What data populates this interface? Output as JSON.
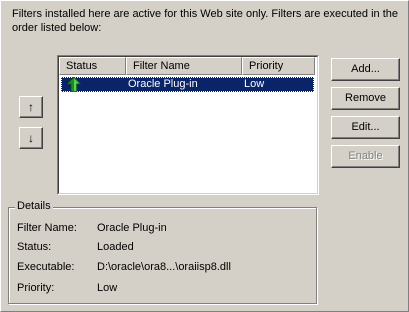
{
  "intro_text": "Filters installed here are active for this Web site only. Filters are executed in the order listed below:",
  "list": {
    "columns": [
      "Status",
      "Filter Name",
      "Priority"
    ],
    "rows": [
      {
        "status_icon": "green-up-arrow-icon",
        "name": "Oracle Plug-in",
        "priority": "Low",
        "selected": true
      }
    ]
  },
  "move_up": {
    "glyph": "↑",
    "icon": "move-up-icon"
  },
  "move_down": {
    "glyph": "↓",
    "icon": "move-down-icon"
  },
  "buttons": {
    "add": "Add...",
    "remove": "Remove",
    "edit": "Edit...",
    "enable": "Enable"
  },
  "details": {
    "title": "Details",
    "filter_name_label": "Filter Name:",
    "filter_name_value": "Oracle Plug-in",
    "status_label": "Status:",
    "status_value": "Loaded",
    "executable_label": "Executable:",
    "executable_value": "D:\\oracle\\ora8...\\oraiisp8.dll",
    "priority_label": "Priority:",
    "priority_value": "Low"
  },
  "colors": {
    "face": "#d4d0c8",
    "selection": "#0a246a",
    "status_green": "#1e8a1e"
  }
}
